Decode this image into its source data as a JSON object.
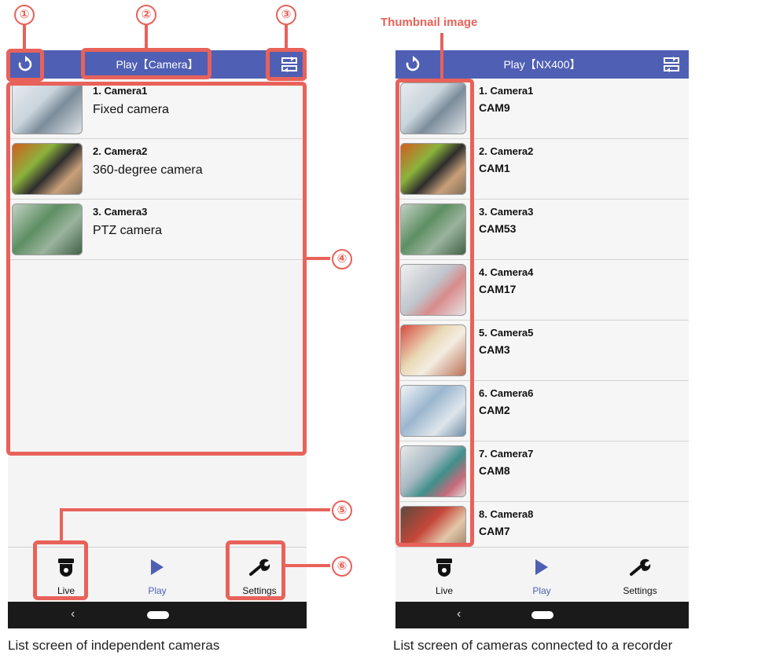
{
  "left_screen": {
    "title": "Play【Camera】",
    "rows": [
      {
        "title": "1. Camera1",
        "subtitle": "Fixed camera"
      },
      {
        "title": "2. Camera2",
        "subtitle": "360-degree camera"
      },
      {
        "title": "3. Camera3",
        "subtitle": "PTZ camera"
      }
    ],
    "tabs": [
      {
        "label": "Live"
      },
      {
        "label": "Play"
      },
      {
        "label": "Settings"
      }
    ],
    "caption": "List screen of independent cameras"
  },
  "right_screen": {
    "title": "Play【NX400】",
    "rows": [
      {
        "title": "1. Camera1",
        "subtitle": "CAM9"
      },
      {
        "title": "2. Camera2",
        "subtitle": "CAM1"
      },
      {
        "title": "3. Camera3",
        "subtitle": "CAM53"
      },
      {
        "title": "4. Camera4",
        "subtitle": "CAM17"
      },
      {
        "title": "5. Camera5",
        "subtitle": "CAM3"
      },
      {
        "title": "6. Camera6",
        "subtitle": "CAM2"
      },
      {
        "title": "7. Camera7",
        "subtitle": "CAM8"
      },
      {
        "title": "8. Camera8",
        "subtitle": "CAM7"
      }
    ],
    "tabs": [
      {
        "label": "Live"
      },
      {
        "label": "Play"
      },
      {
        "label": "Settings"
      }
    ],
    "caption": "List screen of cameras connected to a recorder"
  },
  "callouts": {
    "n1": "①",
    "n2": "②",
    "n3": "③",
    "n4": "④",
    "n5": "⑤",
    "n6": "⑥",
    "thumbnail_label": "Thumbnail image"
  },
  "icons": {
    "refresh": "refresh-icon",
    "switch": "switch-recorder-icon",
    "live": "camera-dome-icon",
    "play": "play-triangle-icon",
    "settings": "wrench-icon",
    "back": "back-chevron-icon",
    "home": "home-pill-icon"
  },
  "colors": {
    "appbar": "#4f5fb4",
    "highlight": "#e8625a",
    "active_tab": "#4f5fb4"
  }
}
